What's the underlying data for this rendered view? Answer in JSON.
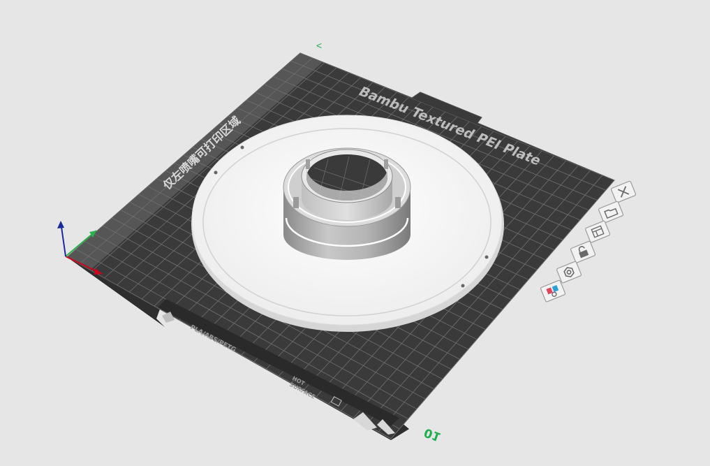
{
  "plate": {
    "brand_label": "Bambu Textured PEI Plate",
    "left_nozzle_label": "仅左喷嘴可打印区域",
    "filament_label": "PLA/ABS/PETG",
    "surface_label_1": "HOT",
    "surface_label_2": "SURFACE",
    "plate_number": "01",
    "corner_marker": "<"
  },
  "plate_toolbar": {
    "buttons": [
      {
        "name": "delete-plate-button",
        "icon": "close-icon"
      },
      {
        "name": "import-to-plate-button",
        "icon": "folder-icon"
      },
      {
        "name": "arrange-plate-button",
        "icon": "arrange-icon"
      },
      {
        "name": "lock-plate-button",
        "icon": "lock-icon"
      },
      {
        "name": "plate-settings-button",
        "icon": "gear-icon"
      },
      {
        "name": "filament-map-button",
        "icon": "filament-map-icon"
      }
    ]
  },
  "colors": {
    "background": "#e6e6e6",
    "plate": "#3a3a3a",
    "grid": "#707070",
    "model": "#f4f4f4",
    "axis_x": "#d0021b",
    "axis_y": "#2bb24c",
    "axis_z": "#1a2a9c",
    "plate_number": "#1fae4b"
  }
}
